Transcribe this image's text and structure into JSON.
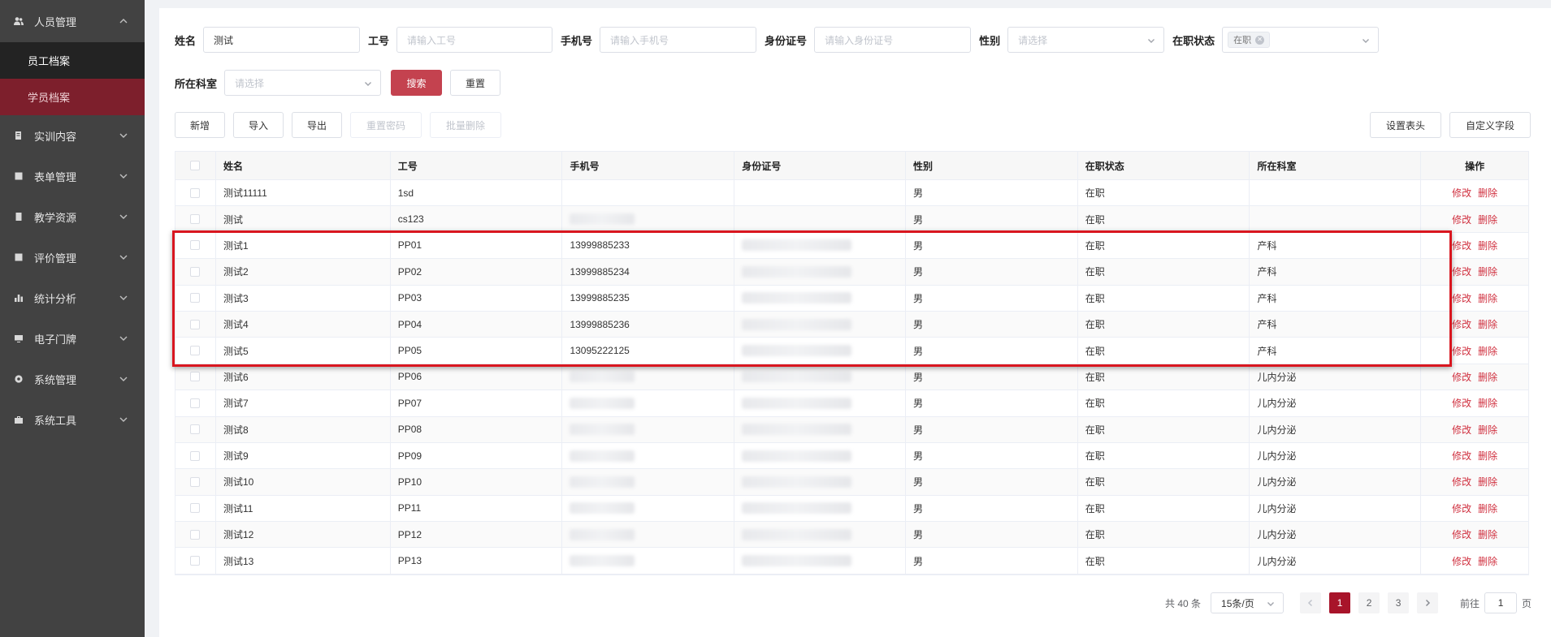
{
  "sidebar": {
    "items": [
      {
        "label": "人员管理",
        "icon": "users-icon",
        "expanded": true
      },
      {
        "label": "实训内容",
        "icon": "book-icon"
      },
      {
        "label": "表单管理",
        "icon": "form-icon"
      },
      {
        "label": "教学资源",
        "icon": "resource-icon"
      },
      {
        "label": "评价管理",
        "icon": "evaluate-icon"
      },
      {
        "label": "统计分析",
        "icon": "bar-chart-icon"
      },
      {
        "label": "电子门牌",
        "icon": "monitor-icon"
      },
      {
        "label": "系统管理",
        "icon": "gear-icon"
      },
      {
        "label": "系统工具",
        "icon": "toolbox-icon"
      }
    ],
    "sub_items": [
      {
        "label": "员工档案"
      },
      {
        "label": "学员档案",
        "active": true
      }
    ]
  },
  "filters": {
    "name_label": "姓名",
    "name_value": "测试",
    "job_no_label": "工号",
    "job_no_placeholder": "请输入工号",
    "phone_label": "手机号",
    "phone_placeholder": "请输入手机号",
    "id_label": "身份证号",
    "id_placeholder": "请输入身份证号",
    "gender_label": "性别",
    "gender_placeholder": "请选择",
    "status_label": "在职状态",
    "status_tag": "在职",
    "dept_label": "所在科室",
    "dept_placeholder": "请选择",
    "search_button": "搜索",
    "reset_button": "重置"
  },
  "toolbar": {
    "add": "新增",
    "import": "导入",
    "export": "导出",
    "reset_password": "重置密码",
    "batch_delete": "批量删除",
    "set_header": "设置表头",
    "custom_fields": "自定义字段"
  },
  "table": {
    "headers": [
      "姓名",
      "工号",
      "手机号",
      "身份证号",
      "性别",
      "在职状态",
      "所在科室",
      "操作"
    ],
    "edit_label": "修改",
    "delete_label": "删除",
    "rows": [
      {
        "name": "测试11111",
        "job_no": "1sd",
        "phone": "",
        "phone_blur": false,
        "id_blur": false,
        "gender": "男",
        "status": "在职",
        "dept": ""
      },
      {
        "name": "测试",
        "job_no": "cs123",
        "phone": "",
        "phone_blur": true,
        "id_blur": false,
        "gender": "男",
        "status": "在职",
        "dept": ""
      },
      {
        "name": "测试1",
        "job_no": "PP01",
        "phone": "13999885233",
        "phone_blur": false,
        "id_blur": true,
        "gender": "男",
        "status": "在职",
        "dept": "产科"
      },
      {
        "name": "测试2",
        "job_no": "PP02",
        "phone": "13999885234",
        "phone_blur": false,
        "id_blur": true,
        "gender": "男",
        "status": "在职",
        "dept": "产科"
      },
      {
        "name": "测试3",
        "job_no": "PP03",
        "phone": "13999885235",
        "phone_blur": false,
        "id_blur": true,
        "gender": "男",
        "status": "在职",
        "dept": "产科"
      },
      {
        "name": "测试4",
        "job_no": "PP04",
        "phone": "13999885236",
        "phone_blur": false,
        "id_blur": true,
        "gender": "男",
        "status": "在职",
        "dept": "产科"
      },
      {
        "name": "测试5",
        "job_no": "PP05",
        "phone": "13095222125",
        "phone_blur": false,
        "id_blur": true,
        "gender": "男",
        "status": "在职",
        "dept": "产科"
      },
      {
        "name": "测试6",
        "job_no": "PP06",
        "phone": "",
        "phone_blur": true,
        "id_blur": true,
        "gender": "男",
        "status": "在职",
        "dept": "儿内分泌"
      },
      {
        "name": "测试7",
        "job_no": "PP07",
        "phone": "",
        "phone_blur": true,
        "id_blur": true,
        "gender": "男",
        "status": "在职",
        "dept": "儿内分泌"
      },
      {
        "name": "测试8",
        "job_no": "PP08",
        "phone": "",
        "phone_blur": true,
        "id_blur": true,
        "gender": "男",
        "status": "在职",
        "dept": "儿内分泌"
      },
      {
        "name": "测试9",
        "job_no": "PP09",
        "phone": "",
        "phone_blur": true,
        "id_blur": true,
        "gender": "男",
        "status": "在职",
        "dept": "儿内分泌"
      },
      {
        "name": "测试10",
        "job_no": "PP10",
        "phone": "",
        "phone_blur": true,
        "id_blur": true,
        "gender": "男",
        "status": "在职",
        "dept": "儿内分泌"
      },
      {
        "name": "测试11",
        "job_no": "PP11",
        "phone": "",
        "phone_blur": true,
        "id_blur": true,
        "gender": "男",
        "status": "在职",
        "dept": "儿内分泌"
      },
      {
        "name": "测试12",
        "job_no": "PP12",
        "phone": "",
        "phone_blur": true,
        "id_blur": true,
        "gender": "男",
        "status": "在职",
        "dept": "儿内分泌"
      },
      {
        "name": "测试13",
        "job_no": "PP13",
        "phone": "",
        "phone_blur": true,
        "id_blur": true,
        "gender": "男",
        "status": "在职",
        "dept": "儿内分泌"
      }
    ]
  },
  "pagination": {
    "total": "共 40 条",
    "page_size": "15条/页",
    "pages": [
      "1",
      "2",
      "3"
    ],
    "current": "1",
    "goto_label": "前往",
    "goto_value": "1",
    "page_suffix": "页"
  },
  "colors": {
    "sidebar_bg": "#424242",
    "active_sub_bg": "#7d1f2c",
    "primary": "#c4424f",
    "link": "#d0303f",
    "highlight_border": "#d9161f"
  }
}
